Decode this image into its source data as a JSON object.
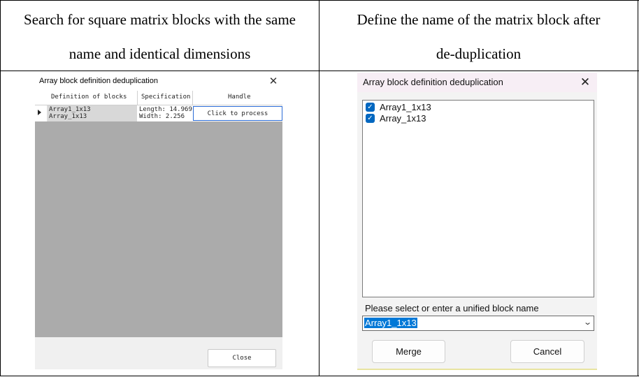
{
  "captions": {
    "left_line1": "Search for square matrix blocks with the same",
    "left_line2": "name and identical dimensions",
    "right_line1": "Define the name of the matrix block after",
    "right_line2": "de-duplication"
  },
  "search_dialog": {
    "title": "Array block definition deduplication",
    "columns": [
      "Definition of blocks",
      "Specification",
      "Handle"
    ],
    "rows": [
      {
        "names": [
          "Array1_1x13",
          "Array_1x13"
        ],
        "spec": [
          "Length: 14.969",
          "Width: 2.256"
        ],
        "handle": "Click to process"
      }
    ],
    "close_label": "Close"
  },
  "rename_dialog": {
    "title": "Array block definition deduplication",
    "items": [
      {
        "label": "Array1_1x13",
        "checked": true
      },
      {
        "label": "Array_1x13",
        "checked": true
      }
    ],
    "unify_label": "Please select or enter a unified block name",
    "selected_name": "Array1_1x13",
    "merge_label": "Merge",
    "cancel_label": "Cancel"
  },
  "icons": {
    "close": "close-icon",
    "row_indicator": "row-arrow-icon",
    "check": "checkbox-checked-icon",
    "dropdown": "chevron-down-icon"
  },
  "colors": {
    "checkbox": "#0067c0",
    "selection": "#0078d7",
    "grid_empty": "#ababab",
    "handle_border": "#2a6bd6"
  }
}
